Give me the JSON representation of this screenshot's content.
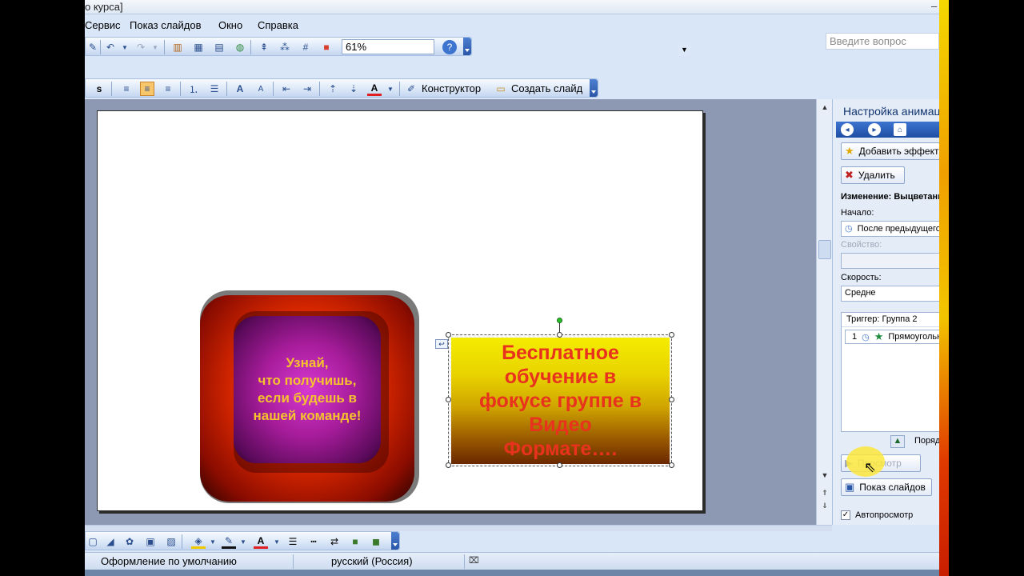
{
  "window": {
    "title": "о курса]",
    "minimize": "–"
  },
  "menu": [
    "Сервис",
    "Показ слайдов",
    "Окно",
    "Справка"
  ],
  "help_box": {
    "placeholder": "Введите вопрос"
  },
  "standard_toolbar": {
    "zoom": "61%"
  },
  "formatting_toolbar": {
    "bold": "s",
    "designer_label": "Конструктор",
    "new_slide_label": "Создать слайд"
  },
  "slide": {
    "button_text": "Узнай,\nчто получишь,\nесли будешь в\nнашей команде!",
    "textbox_text": "Бесплатное\nобучение в\nфокусе группе в\nВидео\nФормате…."
  },
  "animation_pane": {
    "title": "Настройка анимации",
    "add_effect": "Добавить эффект",
    "remove": "Удалить",
    "change_label": "Изменение: Выцветание",
    "start_label": "Начало:",
    "start_value": "После предыдущего",
    "property_label": "Свойство:",
    "speed_label": "Скорость:",
    "speed_value": "Средне",
    "trigger_label": "Триггер: Группа 2",
    "list_item_num": "1",
    "list_item_name": "Прямоугольник",
    "reorder": "Порядок",
    "play": "Просмотр",
    "slideshow": "Показ слайдов",
    "autopreview": "Автопросмотр",
    "autopreview_checked": true
  },
  "status_bar": {
    "design": "Оформление по умолчанию",
    "language": "русский (Россия)"
  },
  "colors": {
    "app_bg": "#d9e6f7",
    "work_bg": "#8d99b3",
    "accent": "#2a56a8"
  }
}
